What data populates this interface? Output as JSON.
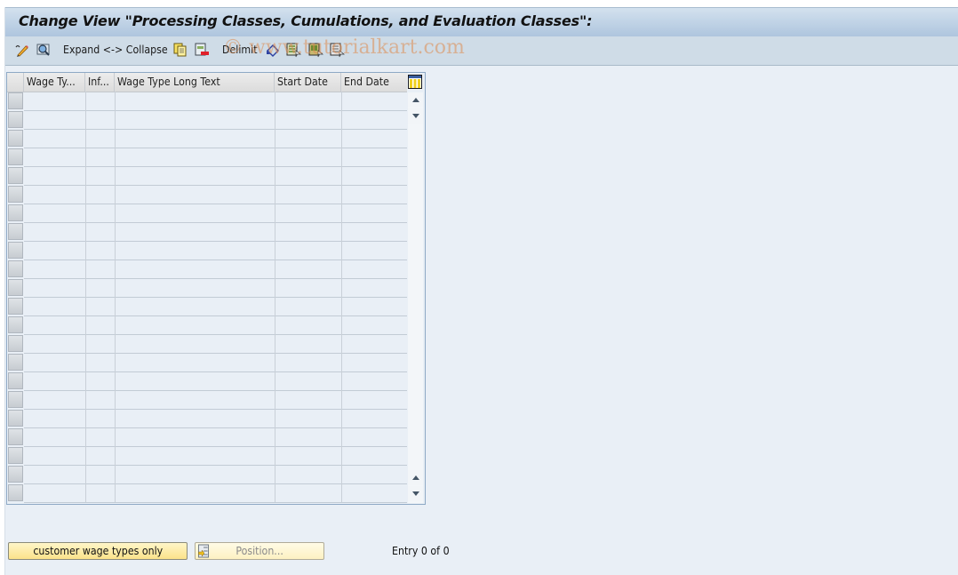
{
  "window": {
    "title": "Change View \"Processing Classes, Cumulations, and Evaluation Classes\":"
  },
  "toolbar": {
    "items": [
      {
        "type": "icon",
        "name": "display-change-icon",
        "tooltip": "Display <-> Change"
      },
      {
        "type": "icon",
        "name": "find-icon",
        "tooltip": "Find"
      },
      {
        "type": "text",
        "label": "Expand <-> Collapse"
      },
      {
        "type": "icon",
        "name": "copy-as-icon",
        "tooltip": "Copy As"
      },
      {
        "type": "icon",
        "name": "delete-icon",
        "tooltip": "Delete"
      },
      {
        "type": "text",
        "label": "Delimit"
      },
      {
        "type": "icon",
        "name": "undo-change-icon",
        "tooltip": "Undo Change"
      },
      {
        "type": "icon",
        "name": "select-all-icon",
        "tooltip": "Select All"
      },
      {
        "type": "icon",
        "name": "select-block-icon",
        "tooltip": "Select Block"
      },
      {
        "type": "icon",
        "name": "deselect-all-icon",
        "tooltip": "Deselect All"
      }
    ],
    "expand_collapse_label": "Expand <-> Collapse",
    "delimit_label": "Delimit",
    "watermark": "© www.tutorialkart.com"
  },
  "table": {
    "columns": [
      {
        "key": "wage_type",
        "label": "Wage Ty..."
      },
      {
        "key": "infotype",
        "label": "Inf..."
      },
      {
        "key": "long_text",
        "label": "Wage Type Long Text"
      },
      {
        "key": "start_date",
        "label": "Start Date"
      },
      {
        "key": "end_date",
        "label": "End Date"
      }
    ],
    "rows": [],
    "visible_empty_rows": 22,
    "layout_button": "column-layout-icon"
  },
  "footer": {
    "customer_button_label": "customer wage types only",
    "position_button_label": "Position...",
    "entry_text": "Entry 0 of 0"
  },
  "colors": {
    "background": "#e9eff6",
    "title_bar": "#b8cde3",
    "toolbar": "#cfdce7",
    "button_yellow": "#fbe28a"
  }
}
